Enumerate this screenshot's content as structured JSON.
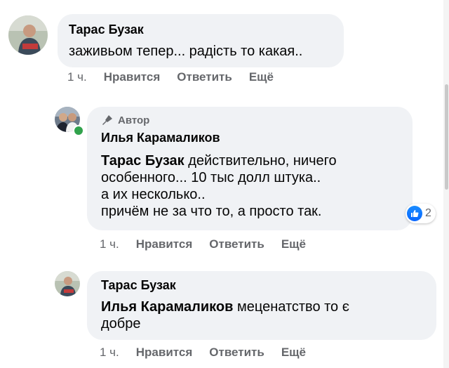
{
  "comments": [
    {
      "author": "Тарас Бузак",
      "text": "заживьом тепер... радість то какая..",
      "actions": {
        "time": "1 ч.",
        "like": "Нравится",
        "reply": "Ответить",
        "more": "Ещё"
      }
    },
    {
      "badge": "Автор",
      "author": "Илья Карамаликов",
      "mention": "Тарас Бузак",
      "lines": [
        " действительно, ничего",
        "особенного... 10 тыс долл штука..",
        "а их несколько..",
        "причём не за что то, а просто так."
      ],
      "reactions": {
        "icon": "thumbs-up-icon",
        "count": "2"
      },
      "actions": {
        "time": "1 ч.",
        "like": "Нравится",
        "reply": "Ответить",
        "more": "Ещё"
      }
    },
    {
      "author": "Тарас Бузак",
      "mention": "Илья Карамаликов",
      "lines": [
        " меценатство то є",
        "добре"
      ],
      "actions": {
        "time": "1 ч.",
        "like": "Нравится",
        "reply": "Ответить",
        "more": "Ещё"
      }
    }
  ],
  "colors": {
    "bubble": "#f0f2f5",
    "meta_text": "#65676b",
    "like_blue": "#0866ff",
    "online": "#31a24c"
  }
}
